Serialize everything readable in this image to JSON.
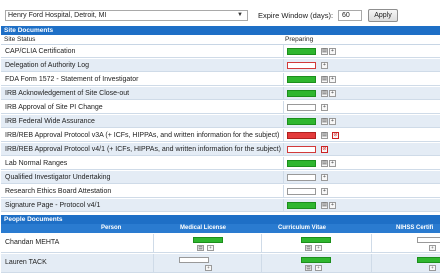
{
  "top": {
    "site_value": "Henry Ford Hospital, Detroit, MI",
    "expire_label": "Expire Window (days):",
    "expire_value": "60",
    "apply_label": "Apply"
  },
  "site_documents": {
    "header": "Site Documents",
    "col_status": "Site Status",
    "col_preparing": "Preparing",
    "rows": [
      {
        "name": "CAP/CLIA Certification",
        "status": "green"
      },
      {
        "name": "Delegation of Authority Log",
        "status": "empty-red"
      },
      {
        "name": "FDA Form 1572 - Statement of Investigator",
        "status": "green"
      },
      {
        "name": "IRB Acknowledgement of Site Close-out",
        "status": "green"
      },
      {
        "name": "IRB Approval of Site PI Change",
        "status": "empty"
      },
      {
        "name": "IRB Federal Wide Assurance",
        "status": "green"
      },
      {
        "name": "IRB/REB Approval Protocol v3A (+ ICFs, HIPPAs, and written information for the subject)",
        "status": "red"
      },
      {
        "name": "IRB/REB Approval Protocol v4/1 (+ ICFs, HIPPAs, and written information for the subject)",
        "status": "empty-red"
      },
      {
        "name": "Lab Normal Ranges",
        "status": "green"
      },
      {
        "name": "Qualified Investigator Undertaking",
        "status": "empty"
      },
      {
        "name": "Research Ethics Board Attestation",
        "status": "empty"
      },
      {
        "name": "Signature Page - Protocol v4/1",
        "status": "green"
      }
    ]
  },
  "people_documents": {
    "header": "People Documents",
    "columns": [
      "Person",
      "Medical License",
      "Curriculum Vitae",
      "NIHSS Certifi"
    ],
    "rows": [
      {
        "name": "Chandan MEHTA"
      },
      {
        "name": "Lauren TACK"
      }
    ]
  },
  "colors": {
    "header_blue": "#1e6fc6",
    "green": "#2fb62f",
    "red": "#e33a3a",
    "alt_row": "#e4ecf5"
  }
}
